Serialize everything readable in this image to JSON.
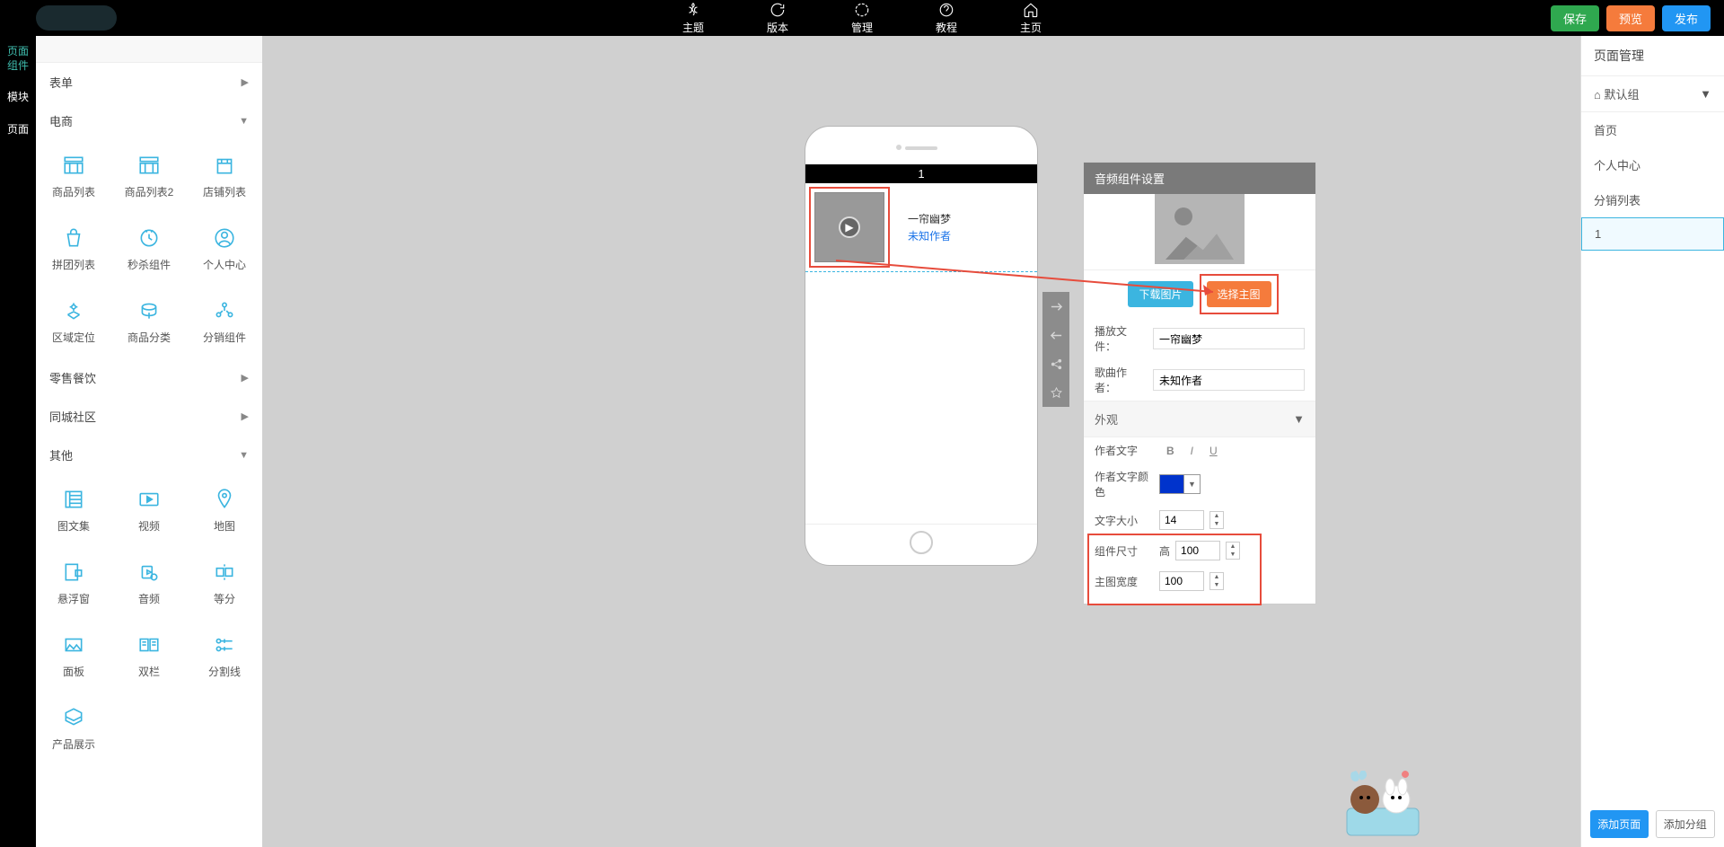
{
  "topbar": {
    "items": [
      "主题",
      "版本",
      "管理",
      "教程",
      "主页"
    ],
    "save": "保存",
    "preview": "预览",
    "publish": "发布"
  },
  "leftnav": {
    "components": "页面\n组件",
    "modules": "模块",
    "pages": "页面"
  },
  "panels": {
    "form": "表单",
    "ecommerce": "电商",
    "retail": "零售餐饮",
    "community": "同城社区",
    "other": "其他"
  },
  "ecommerce_items": [
    "商品列表",
    "商品列表2",
    "店铺列表",
    "拼团列表",
    "秒杀组件",
    "个人中心",
    "区域定位",
    "商品分类",
    "分销组件"
  ],
  "other_items": [
    "图文集",
    "视频",
    "地图",
    "悬浮窗",
    "音频",
    "等分",
    "面板",
    "双栏",
    "分割线",
    "产品展示"
  ],
  "phone": {
    "title": "1",
    "audio_title": "一帘幽梦",
    "audio_author": "未知作者"
  },
  "settings": {
    "header": "音频组件设置",
    "download": "下载图片",
    "select_image": "选择主图",
    "play_file_label": "播放文件：",
    "play_file_value": "一帘幽梦",
    "author_label": "歌曲作者：",
    "author_value": "未知作者",
    "appearance": "外观",
    "author_text_label": "作者文字",
    "author_color_label": "作者文字颜色",
    "font_size_label": "文字大小",
    "font_size_value": "14",
    "comp_size_label": "组件尺寸",
    "height_label": "高",
    "height_value": "100",
    "img_width_label": "主图宽度",
    "img_width_value": "100",
    "colors": {
      "author": "#0033cc"
    }
  },
  "rightbar": {
    "header": "页面管理",
    "group": "默认组",
    "pages": [
      "首页",
      "个人中心",
      "分销列表",
      "1"
    ],
    "add_page": "添加页面",
    "add_group": "添加分组"
  }
}
